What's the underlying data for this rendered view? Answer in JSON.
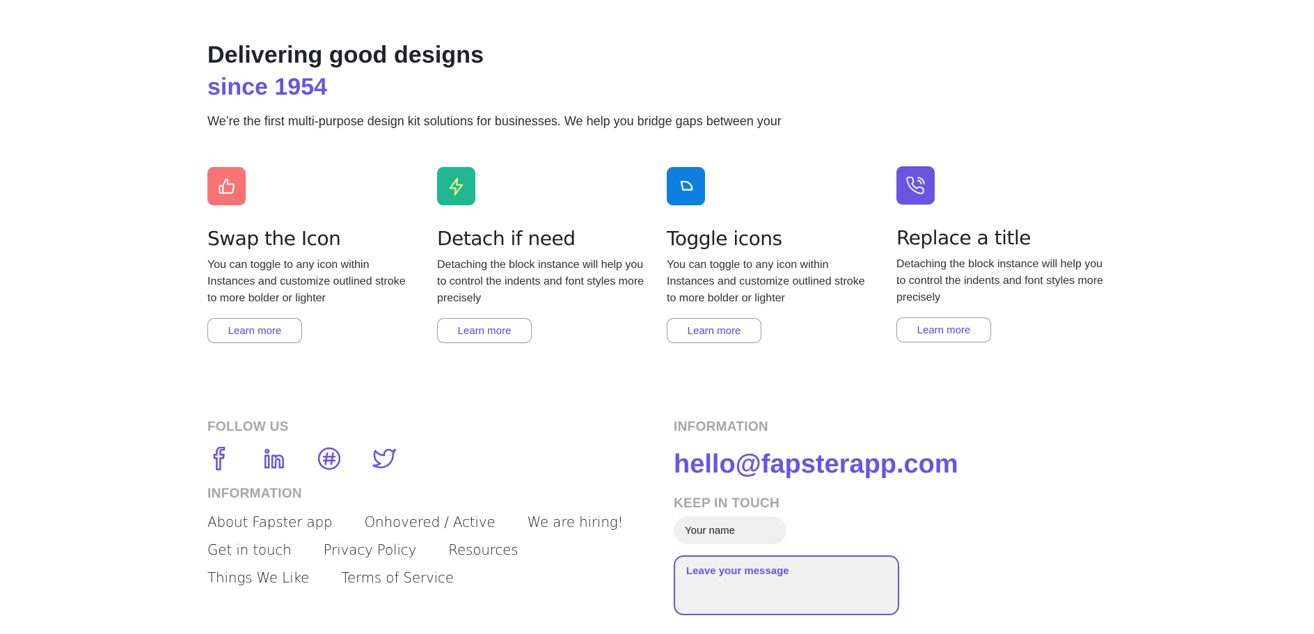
{
  "hero": {
    "title": "Delivering good designs",
    "subtitle": "since 1954",
    "description": "We’re the first multi-purpose design kit solutions for businesses. We help you bridge gaps between your"
  },
  "features": [
    {
      "icon": "thumbs-up-icon",
      "color": "#f87474",
      "title": "Swap the Icon",
      "text": "You can toggle to any icon within Instances and customize outlined stroke to more bolder or lighter",
      "button": "Learn more"
    },
    {
      "icon": "lightning-icon",
      "color": "#1fb892",
      "title": "Detach if need",
      "text": "Detaching the block instance will help you to control the indents and font styles more precisely",
      "button": "Learn more"
    },
    {
      "icon": "quarter-circle-icon",
      "color": "#0c7fdf",
      "title": "Toggle icons",
      "text": "You can toggle to any icon within Instances and customize outlined stroke to more bolder or lighter",
      "button": "Learn more"
    },
    {
      "icon": "phone-call-icon",
      "color": "#6a54e0",
      "title": "Replace a title",
      "text": "Detaching the block instance will help you to control the indents and font styles more precisely",
      "button": "Learn more"
    }
  ],
  "footer": {
    "follow_label": "FOLLOW US",
    "social": [
      "facebook-icon",
      "linkedin-icon",
      "slack-icon",
      "twitter-icon"
    ],
    "info_label": "INFORMATION",
    "links": [
      [
        "About Fapster app",
        "Onhovered / Active",
        "We are hiring!"
      ],
      [
        "Get in touch",
        "Privacy Policy",
        "Resources"
      ],
      [
        "Things We Like",
        "Terms of Service"
      ]
    ],
    "right_info_label": "INFORMATION",
    "email": "hello@fapsterapp.com",
    "keep_label": "KEEP IN TOUCH",
    "name_placeholder": "Your name",
    "message_placeholder": "Leave your message"
  },
  "colors": {
    "accent": "#6a54e0",
    "muted_label": "#a6a6ad"
  }
}
